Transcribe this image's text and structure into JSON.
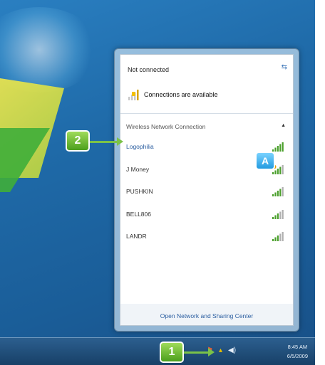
{
  "network_popup": {
    "status": "Not connected",
    "availability": "Connections are available",
    "section_title": "Wireless Network Connection",
    "networks": [
      {
        "name": "Logophilia",
        "signal_level": 5,
        "secured": false
      },
      {
        "name": "J Money",
        "signal_level": 4,
        "secured": true
      },
      {
        "name": "PUSHKIN",
        "signal_level": 4,
        "secured": false
      },
      {
        "name": "BELL806",
        "signal_level": 3,
        "secured": false
      },
      {
        "name": "LANDR",
        "signal_level": 3,
        "secured": false
      }
    ],
    "footer_link": "Open Network and Sharing Center"
  },
  "taskbar": {
    "time": "8:45 AM",
    "date": "6/5/2009"
  },
  "callouts": {
    "step1": "1",
    "step2": "2",
    "marker_a": "A"
  },
  "colors": {
    "desktop": "#1f6aa8",
    "signal_green": "#4a9f2b",
    "signal_gray": "#b0b0b0",
    "callout_green": "#6bbf35",
    "callout_blue": "#2aa5e6"
  }
}
